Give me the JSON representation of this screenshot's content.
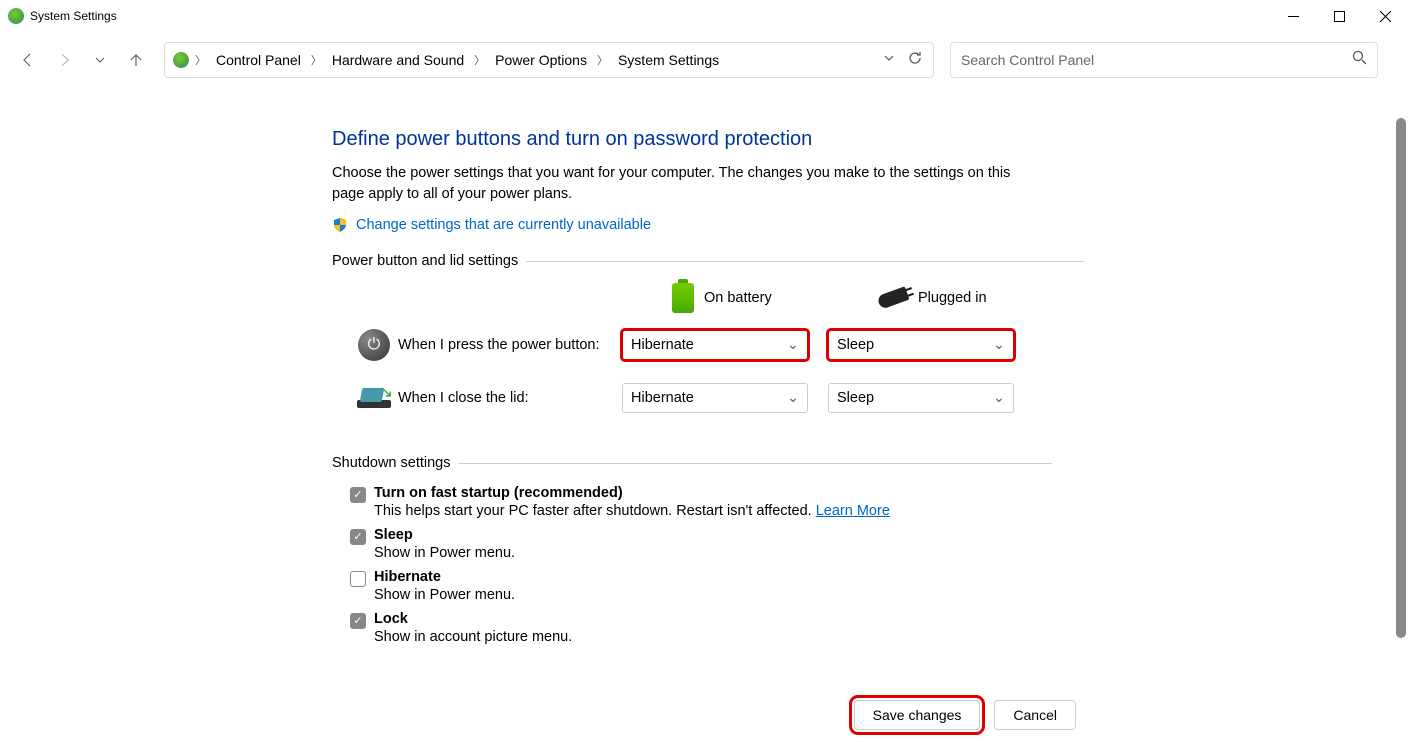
{
  "window": {
    "title": "System Settings"
  },
  "breadcrumb": {
    "items": [
      "Control Panel",
      "Hardware and Sound",
      "Power Options",
      "System Settings"
    ]
  },
  "search": {
    "placeholder": "Search Control Panel"
  },
  "page": {
    "title": "Define power buttons and turn on password protection",
    "desc": "Choose the power settings that you want for your computer. The changes you make to the settings on this page apply to all of your power plans.",
    "admin_link": "Change settings that are currently unavailable"
  },
  "groups": {
    "power_button": {
      "legend": "Power button and lid settings",
      "col_battery": "On battery",
      "col_plugged": "Plugged in",
      "rows": [
        {
          "label": "When I press the power button:",
          "battery": "Hibernate",
          "plugged": "Sleep",
          "highlight": true
        },
        {
          "label": "When I close the lid:",
          "battery": "Hibernate",
          "plugged": "Sleep",
          "highlight": false
        }
      ]
    },
    "shutdown": {
      "legend": "Shutdown settings",
      "items": [
        {
          "title": "Turn on fast startup (recommended)",
          "desc": "This helps start your PC faster after shutdown. Restart isn't affected. ",
          "learn": "Learn More",
          "checked": true
        },
        {
          "title": "Sleep",
          "desc": "Show in Power menu.",
          "checked": true
        },
        {
          "title": "Hibernate",
          "desc": "Show in Power menu.",
          "checked": false
        },
        {
          "title": "Lock",
          "desc": "Show in account picture menu.",
          "checked": true
        }
      ]
    }
  },
  "footer": {
    "save": "Save changes",
    "cancel": "Cancel"
  }
}
